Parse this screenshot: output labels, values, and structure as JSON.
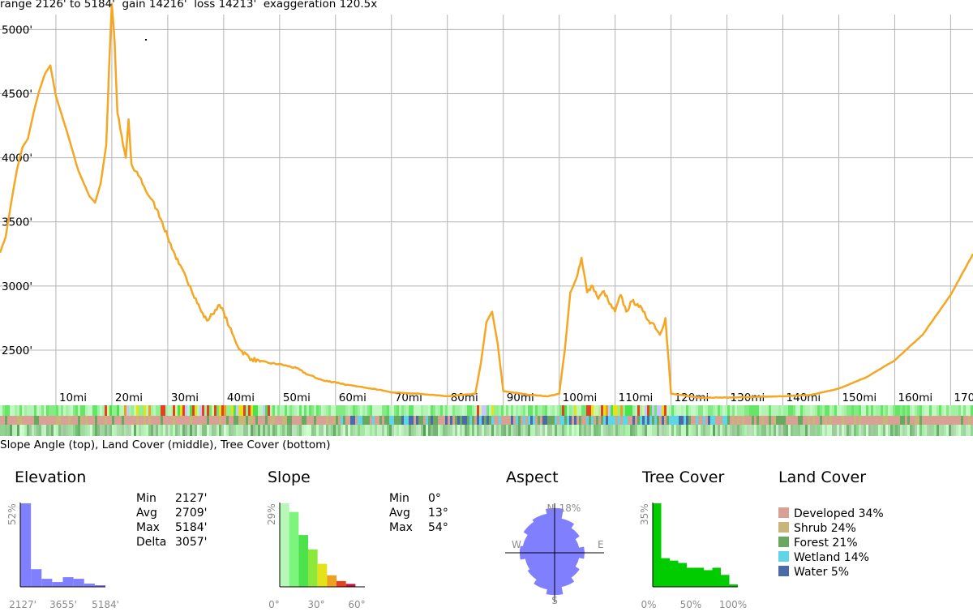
{
  "header": {
    "range_label": "range",
    "range_min": "2126'",
    "range_to": "to",
    "range_max": "5184'",
    "gain_label": "gain",
    "gain_value": "14216'",
    "loss_label": "loss",
    "loss_value": "14213'",
    "exaggeration_label": "exaggeration",
    "exaggeration_value": "120.5x"
  },
  "chart_data": {
    "type": "line",
    "line_color": "#f5a623",
    "x_unit": "mi",
    "x_ticks": [
      "10mi",
      "20mi",
      "30mi",
      "40mi",
      "50mi",
      "60mi",
      "70mi",
      "80mi",
      "90mi",
      "100mi",
      "110mi",
      "120mi",
      "130mi",
      "140mi",
      "150mi",
      "160mi",
      "170"
    ],
    "x_tick_values": [
      10,
      20,
      30,
      40,
      50,
      60,
      70,
      80,
      90,
      100,
      110,
      120,
      130,
      140,
      150,
      160,
      170
    ],
    "y_ticks": [
      "2500'",
      "3000'",
      "3500'",
      "4000'",
      "4500'",
      "5000'"
    ],
    "y_tick_values": [
      2500,
      3000,
      3500,
      4000,
      4500,
      5000
    ],
    "xlim": [
      0,
      174
    ],
    "ylim": [
      2070,
      5230
    ],
    "grid": true,
    "x": [
      0,
      1,
      2,
      3,
      4,
      5,
      6,
      7,
      8,
      9,
      10,
      12,
      14,
      16,
      17,
      18,
      19,
      19.5,
      20,
      20.5,
      21,
      22,
      22.5,
      23,
      23.5,
      24,
      25,
      26,
      27,
      28,
      29,
      30,
      32,
      34,
      36,
      37,
      38,
      39,
      40,
      41,
      42,
      43,
      45,
      48,
      50,
      53,
      55,
      58,
      60,
      62,
      65,
      68,
      70,
      75,
      80,
      85,
      86,
      87,
      88,
      89,
      90,
      95,
      98,
      100,
      101,
      102,
      103,
      104,
      105,
      106,
      107,
      108,
      109,
      110,
      111,
      112,
      113,
      114,
      115,
      116,
      117,
      118,
      119,
      120,
      125,
      130,
      135,
      140,
      145,
      150,
      155,
      160,
      165,
      170,
      174
    ],
    "y": [
      3260,
      3380,
      3650,
      3900,
      4080,
      4150,
      4350,
      4520,
      4650,
      4720,
      4480,
      4200,
      3900,
      3700,
      3650,
      3800,
      4100,
      4700,
      5200,
      4900,
      4350,
      4100,
      4000,
      4300,
      3950,
      3900,
      3850,
      3750,
      3680,
      3600,
      3500,
      3380,
      3170,
      3000,
      2800,
      2730,
      2780,
      2850,
      2800,
      2680,
      2580,
      2500,
      2430,
      2400,
      2390,
      2360,
      2310,
      2260,
      2250,
      2230,
      2210,
      2190,
      2170,
      2160,
      2140,
      2160,
      2400,
      2720,
      2800,
      2550,
      2180,
      2150,
      2140,
      2160,
      2500,
      2950,
      3050,
      3220,
      2950,
      3000,
      2900,
      2960,
      2860,
      2800,
      2930,
      2800,
      2880,
      2860,
      2800,
      2730,
      2700,
      2620,
      2750,
      2160,
      2130,
      2130,
      2135,
      2140,
      2150,
      2200,
      2290,
      2420,
      2620,
      2930,
      3250
    ]
  },
  "strips": {
    "caption": "Slope Angle (top), Land Cover (middle), Tree Cover (bottom)"
  },
  "elevation": {
    "title": "Elevation",
    "stats": [
      {
        "label": "Min",
        "value": "2127'"
      },
      {
        "label": "Avg",
        "value": "2709'"
      },
      {
        "label": "Max",
        "value": "5184'"
      },
      {
        "label": "Delta",
        "value": "3057'"
      }
    ],
    "max_pct_label": "52%",
    "color": "#8080ff",
    "bins": [
      52,
      11,
      5,
      3,
      6,
      5,
      2,
      1
    ],
    "x_labels": [
      "2127'",
      "3655'",
      "5184'"
    ]
  },
  "slope": {
    "title": "Slope",
    "stats": [
      {
        "label": "Min",
        "value": "0°"
      },
      {
        "label": "Avg",
        "value": "13°"
      },
      {
        "label": "Max",
        "value": "54°"
      }
    ],
    "max_pct_label": "29%",
    "bins": [
      29,
      26,
      18,
      13,
      8,
      4,
      2,
      1,
      0
    ],
    "colors": [
      "#b7f7b7",
      "#7df57d",
      "#4be24b",
      "#8ee83a",
      "#e6e21a",
      "#f0a020",
      "#e74020",
      "#c01040",
      "#900070"
    ],
    "x_labels": [
      "0°",
      "30°",
      "60°"
    ]
  },
  "aspect": {
    "title": "Aspect",
    "max_pct_label": "18%",
    "color": "#8080ff",
    "directions": {
      "north": "N",
      "east": "E",
      "south": "S",
      "west": "W"
    },
    "sectors": [
      18,
      14,
      12,
      10,
      12,
      10,
      12,
      14,
      17,
      15,
      13,
      12,
      14,
      13,
      15,
      16
    ]
  },
  "tree_cover": {
    "title": "Tree Cover",
    "max_pct_label": "35%",
    "color": "#00cc00",
    "bins": [
      35,
      12,
      11,
      10,
      8,
      8,
      7,
      8,
      5,
      1
    ],
    "x_labels": [
      "0%",
      "50%",
      "100%"
    ]
  },
  "land_cover": {
    "title": "Land Cover",
    "items": [
      {
        "label": "Developed 34%",
        "color": "#d9a193"
      },
      {
        "label": "Shrub 24%",
        "color": "#c9b57a"
      },
      {
        "label": "Forest 21%",
        "color": "#6aa860"
      },
      {
        "label": "Wetland 14%",
        "color": "#5fd6e8"
      },
      {
        "label": "Water 5%",
        "color": "#4a6aa8"
      }
    ]
  }
}
